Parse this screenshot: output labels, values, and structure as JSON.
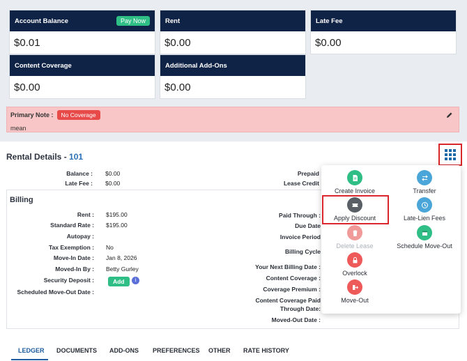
{
  "cards": [
    {
      "title": "Account Balance",
      "value": "$0.01",
      "action": "Pay Now"
    },
    {
      "title": "Rent",
      "value": "$0.00"
    },
    {
      "title": "Late Fee",
      "value": "$0.00"
    },
    {
      "title": "Content Coverage",
      "value": "$0.00"
    },
    {
      "title": "Additional Add-Ons",
      "value": "$0.00"
    }
  ],
  "note": {
    "label": "Primary Note :",
    "badge": "No Coverage",
    "text": "mean"
  },
  "rental": {
    "title": "Rental Details -",
    "number": "101",
    "balance_label": "Balance :",
    "balance": "$0.00",
    "latefee_label": "Late Fee :",
    "latefee": "$0.00",
    "prepaid_label": "Prepaid",
    "lease_credit_label": "Lease Credit"
  },
  "billing": {
    "title": "Billing",
    "left": [
      {
        "label": "Rent :",
        "value": "$195.00"
      },
      {
        "label": "Standard Rate :",
        "value": "$195.00"
      },
      {
        "label": "Autopay :",
        "value": ""
      },
      {
        "label": "Tax Exemption :",
        "value": "No"
      },
      {
        "label": "Move-In Date :",
        "value": "Jan 8, 2026"
      },
      {
        "label": "Moved-In By :",
        "value": "Betty Gurley"
      },
      {
        "label": "Security Deposit :",
        "value": ""
      },
      {
        "label": "Scheduled Move-Out Date :",
        "value": ""
      }
    ],
    "add_label": "Add",
    "info_glyph": "i",
    "right": [
      "Paid Through :",
      "Due Date",
      "Invoice Period",
      "Billing Cycle",
      "Your Next Billing Date :",
      "Content Coverage :",
      "Coverage Premium :",
      "Content Coverage Paid",
      "Through Date:",
      "Moved-Out Date :"
    ]
  },
  "menu": [
    {
      "label": "Create Invoice",
      "color": "#2fbf86",
      "icon": "document-icon"
    },
    {
      "label": "Transfer",
      "color": "#4aa6d8",
      "icon": "transfer-icon"
    },
    {
      "label": "Apply Discount",
      "color": "#5a5f66",
      "icon": "ticket-icon"
    },
    {
      "label": "Late-Lien Fees",
      "color": "#4aa6d8",
      "icon": "clock-icon"
    },
    {
      "label": "Delete Lease",
      "color": "#f19a9a",
      "icon": "trash-icon",
      "disabled": true
    },
    {
      "label": "Schedule Move-Out",
      "color": "#2fbf86",
      "icon": "calendar-icon"
    },
    {
      "label": "Overlock",
      "color": "#ee5a5a",
      "icon": "lock-icon"
    },
    {
      "label": "Move-Out",
      "color": "#ee5a5a",
      "icon": "exit-icon"
    }
  ],
  "tabs": [
    "LEDGER",
    "DOCUMENTS",
    "ADD-ONS",
    "PREFERENCES",
    "OTHER",
    "RATE HISTORY"
  ]
}
